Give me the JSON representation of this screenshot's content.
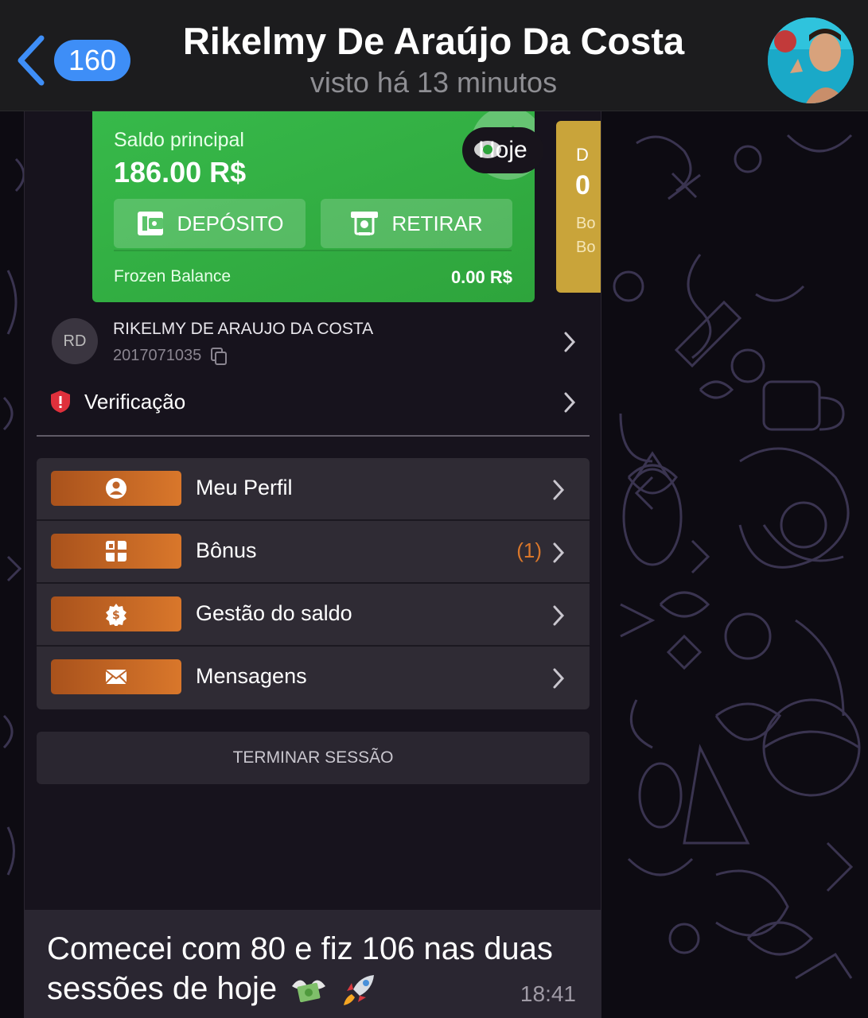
{
  "header": {
    "back_count": "160",
    "contact_name": "Rikelmy De Araújo Da Costa",
    "last_seen": "visto há 13 minutos"
  },
  "screenshot": {
    "balance_card": {
      "label": "Saldo principal",
      "value": "186.00 R$",
      "date_chip": "Hoje",
      "deposit_label": "DEPÓSITO",
      "withdraw_label": "RETIRAR",
      "frozen_label": "Frozen Balance",
      "frozen_value": "0.00 R$"
    },
    "bonus_card_partial": {
      "line1": "D",
      "line2": "0",
      "line3": "Bo",
      "line4": "Bo"
    },
    "user": {
      "initials": "RD",
      "name": "RIKELMY DE ARAUJO DA COSTA",
      "id": "2017071035"
    },
    "verification_label": "Verificação",
    "menu": [
      {
        "label": "Meu Perfil",
        "icon": "user-icon",
        "count": ""
      },
      {
        "label": "Bônus",
        "icon": "gift-icon",
        "count": "(1)"
      },
      {
        "label": "Gestão do saldo",
        "icon": "money-gear-icon",
        "count": ""
      },
      {
        "label": "Mensagens",
        "icon": "envelope-icon",
        "count": ""
      }
    ],
    "logout_label": "TERMINAR SESSÃO"
  },
  "message": {
    "text": "Comecei com 80 e fiz 106 nas duas sessões de hoje",
    "emojis": [
      "money-with-wings-icon",
      "rocket-icon"
    ],
    "time": "18:41"
  },
  "colors": {
    "header_bg": "#1c1c1e",
    "badge": "#3e8ef7",
    "balance_green": "#33b146",
    "bonus_gold": "#c9a43a",
    "menu_orange": "#d9772b",
    "menu_bg": "#2f2b34"
  }
}
